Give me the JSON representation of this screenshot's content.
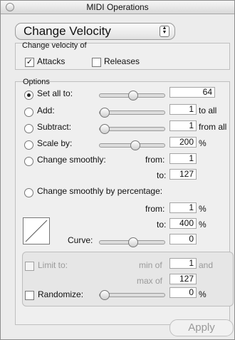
{
  "window": {
    "title": "MIDI Operations"
  },
  "popup": {
    "selected": "Change Velocity"
  },
  "velocity": {
    "label": "Change velocity of",
    "attacks": "Attacks",
    "releases": "Releases"
  },
  "options": {
    "label": "Options",
    "set_all": {
      "label": "Set all to:",
      "value": "64"
    },
    "add": {
      "label": "Add:",
      "value": "1",
      "suffix": "to all"
    },
    "subtract": {
      "label": "Subtract:",
      "value": "1",
      "suffix": "from all"
    },
    "scale": {
      "label": "Scale by:",
      "value": "200",
      "suffix": "%"
    },
    "smooth": {
      "label": "Change smoothly:",
      "from_label": "from:",
      "from_value": "1",
      "to_label": "to:",
      "to_value": "127"
    },
    "smooth_pct": {
      "label": "Change smoothly by percentage:",
      "from_label": "from:",
      "from_value": "1",
      "from_suffix": "%",
      "to_label": "to:",
      "to_value": "400",
      "to_suffix": "%"
    },
    "curve": {
      "label": "Curve:",
      "value": "0"
    }
  },
  "limits": {
    "limit_label": "Limit to:",
    "min_label": "min of",
    "min_value": "1",
    "and_label": "and",
    "max_label": "max of",
    "max_value": "127",
    "randomize_label": "Randomize:",
    "randomize_value": "0",
    "randomize_suffix": "%"
  },
  "actions": {
    "apply": "Apply"
  },
  "sliders": {
    "set_all": 0.5,
    "add": 0.0,
    "subtract": 0.0,
    "scale": 0.55,
    "curve": 0.5,
    "randomize": 0.0
  }
}
